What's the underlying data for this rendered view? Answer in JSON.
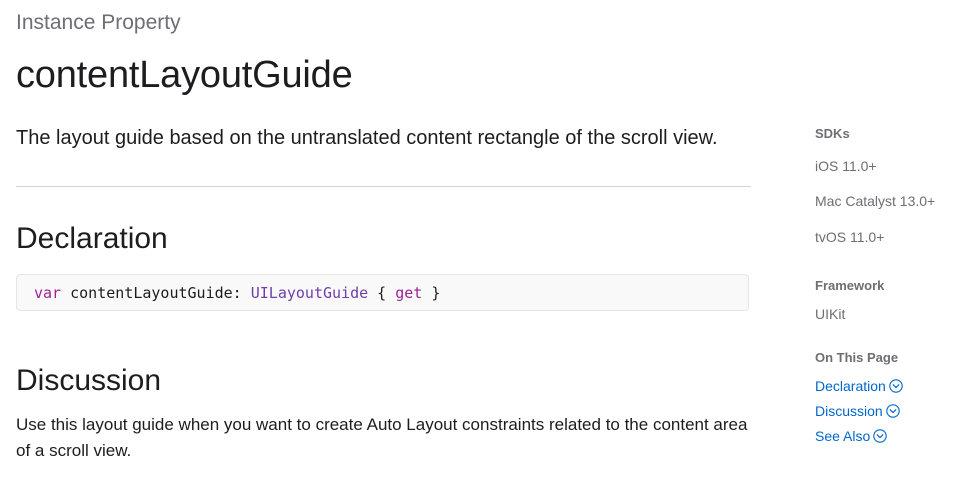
{
  "header": {
    "eyebrow": "Instance Property",
    "title": "contentLayoutGuide",
    "abstract": "The layout guide based on the untranslated content rectangle of the scroll view."
  },
  "declaration": {
    "heading": "Declaration",
    "code": {
      "kw_var": "var",
      "name": " contentLayoutGuide: ",
      "type": "UILayoutGuide",
      "brace_open": " { ",
      "kw_get": "get",
      "brace_close": " }"
    }
  },
  "discussion": {
    "heading": "Discussion",
    "text": "Use this layout guide when you want to create Auto Layout constraints related to the content area of a scroll view."
  },
  "sidebar": {
    "sdks_label": "SDKs",
    "sdks": [
      "iOS 11.0+",
      "Mac Catalyst 13.0+",
      "tvOS 11.0+"
    ],
    "framework_label": "Framework",
    "framework": "UIKit",
    "on_this_page_label": "On This Page",
    "links": [
      "Declaration",
      "Discussion",
      "See Also"
    ]
  },
  "colors": {
    "link": "#0066cc",
    "keyword": "#9b2393",
    "type": "#703daa",
    "muted": "#6e6e73"
  },
  "icons": {
    "section_link": "chevron-down-circle-icon"
  }
}
